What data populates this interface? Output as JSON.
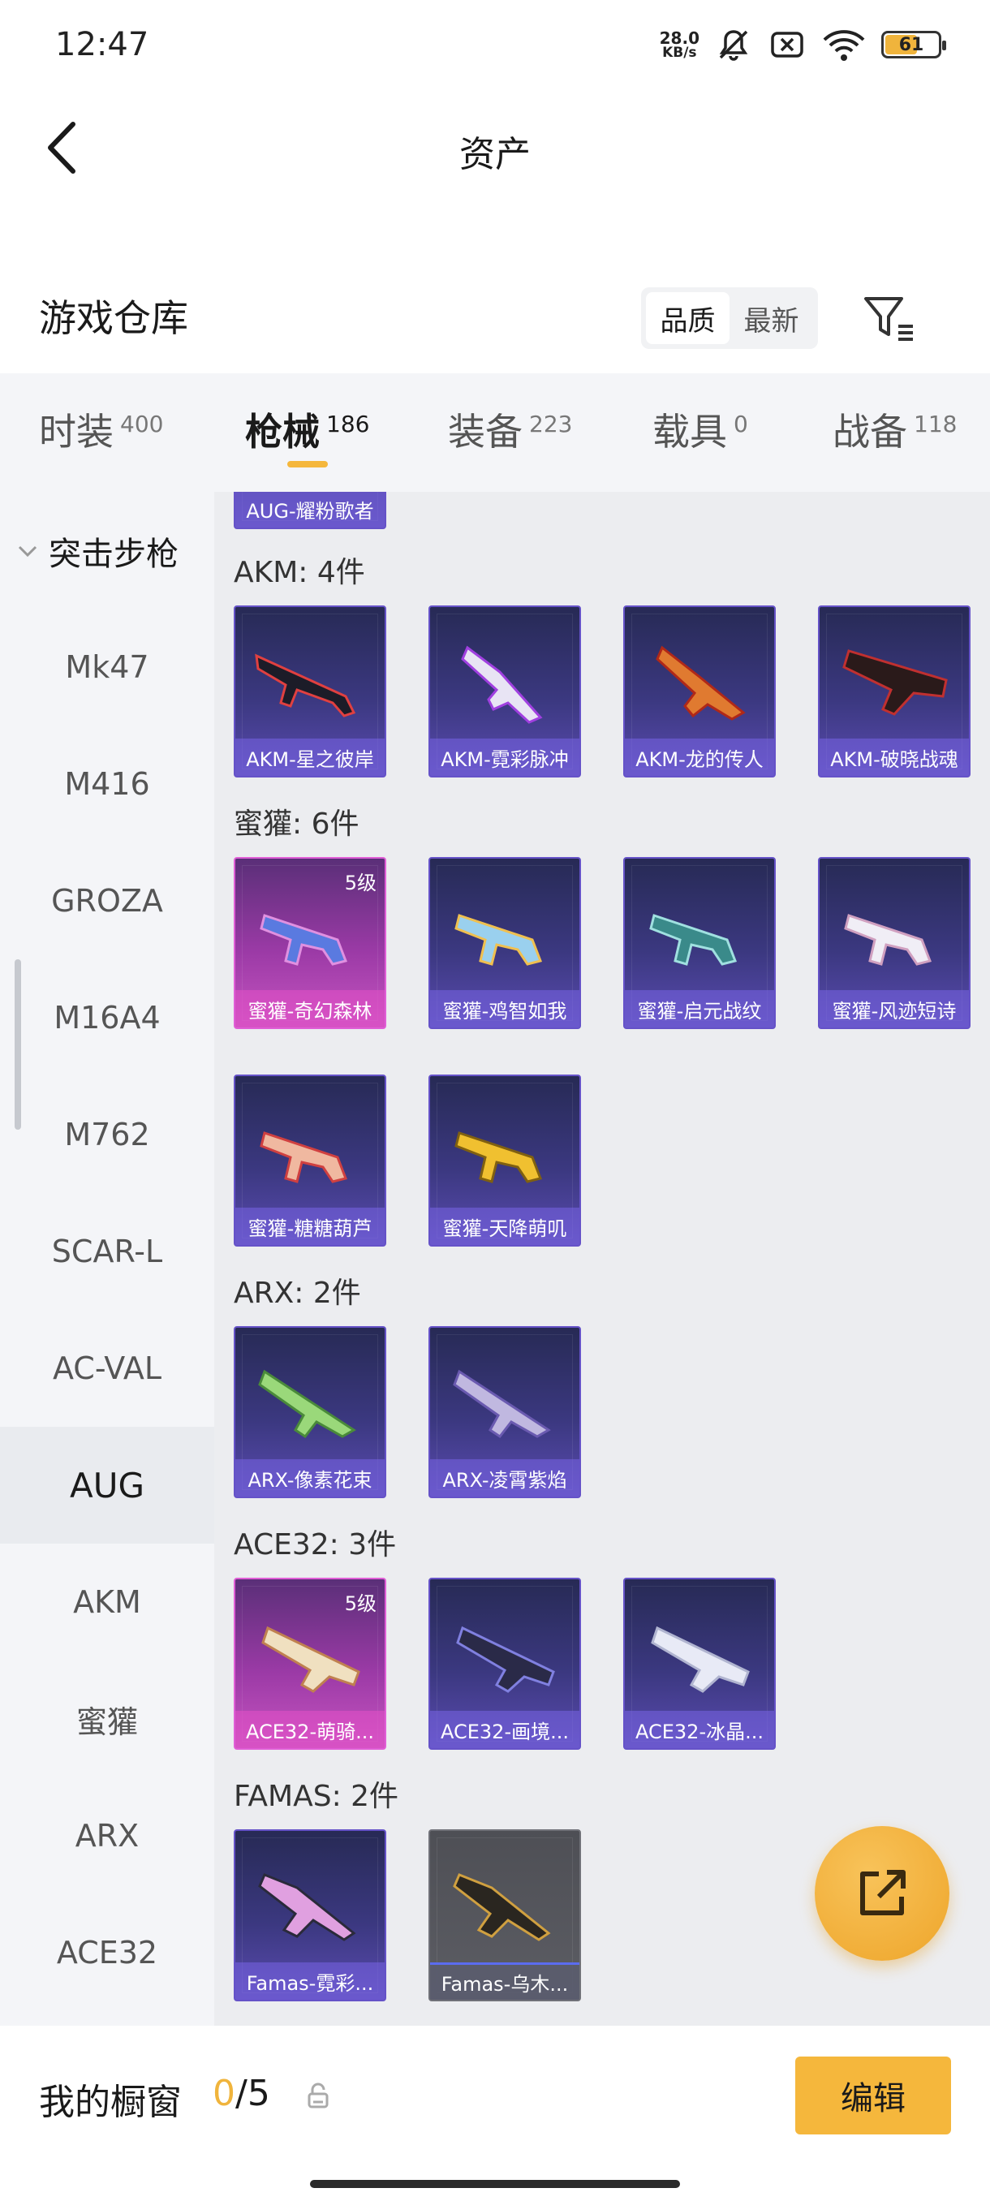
{
  "status_bar": {
    "time": "12:47",
    "net_speed_value": "28.0",
    "net_speed_unit": "KB/s",
    "battery": "61"
  },
  "header": {
    "title": "资产"
  },
  "warehouse": {
    "title": "游戏仓库",
    "sort_options": [
      "品质",
      "最新"
    ],
    "active_sort": "品质"
  },
  "tabs": [
    {
      "label": "时装",
      "count": "400"
    },
    {
      "label": "枪械",
      "count": "186",
      "active": true
    },
    {
      "label": "装备",
      "count": "223"
    },
    {
      "label": "载具",
      "count": "0"
    },
    {
      "label": "战备",
      "count": "118"
    }
  ],
  "sidebar": {
    "group": "突击步枪",
    "items": [
      "Mk47",
      "M416",
      "GROZA",
      "M16A4",
      "M762",
      "SCAR-L",
      "AC-VAL",
      "AUG",
      "AKM",
      "蜜獾",
      "ARX",
      "ACE32"
    ],
    "active": "AUG"
  },
  "content": {
    "top_partial_card": "AUG-耀粉歌者",
    "sections": [
      {
        "title": "AKM: 4件",
        "items": [
          {
            "name": "AKM-星之彼岸"
          },
          {
            "name": "AKM-霓彩脉冲"
          },
          {
            "name": "AKM-龙的传人"
          },
          {
            "name": "AKM-破晓战魂"
          }
        ]
      },
      {
        "title": "蜜獾: 6件",
        "items": [
          {
            "name": "蜜獾-奇幻森林",
            "level": "5级"
          },
          {
            "name": "蜜獾-鸡智如我"
          },
          {
            "name": "蜜獾-启元战纹"
          },
          {
            "name": "蜜獾-风迹短诗"
          },
          {
            "name": "蜜獾-糖糖葫芦"
          },
          {
            "name": "蜜獾-天降萌叽"
          }
        ]
      },
      {
        "title": "ARX: 2件",
        "items": [
          {
            "name": "ARX-像素花束"
          },
          {
            "name": "ARX-凌霄紫焰"
          }
        ]
      },
      {
        "title": "ACE32: 3件",
        "items": [
          {
            "name": "ACE32-萌骑...",
            "level": "5级"
          },
          {
            "name": "ACE32-画境..."
          },
          {
            "name": "ACE32-冰晶..."
          }
        ]
      },
      {
        "title": "FAMAS: 2件",
        "items": [
          {
            "name": "Famas-霓彩..."
          },
          {
            "name": "Famas-乌木..."
          }
        ]
      }
    ]
  },
  "showcase": {
    "label": "我的橱窗",
    "current": "0",
    "separator": "/",
    "total": "5",
    "edit_label": "编辑"
  },
  "colors": {
    "accent": "#f5b73c",
    "card_purple": "#3b3880",
    "card_pink": "#c654c0"
  }
}
